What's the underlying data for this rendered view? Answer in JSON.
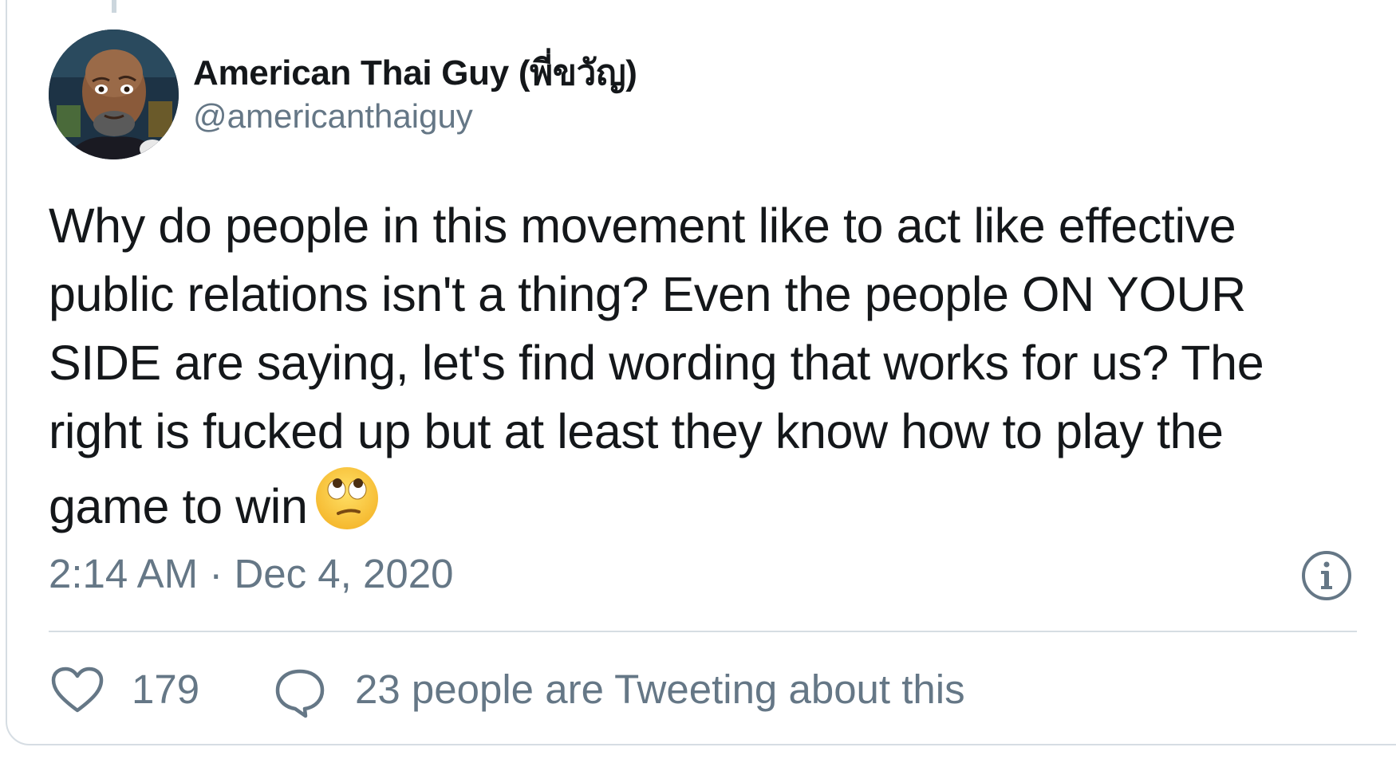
{
  "tweet": {
    "author": {
      "display_name": "American Thai Guy (พี่ขวัญ)",
      "handle": "@americanthaiguy"
    },
    "text": "Why do people in this movement like to act like effective public relations isn't a thing? Even the people ON YOUR SIDE are saying, let's find wording that works for us? The right is fucked up but at least they know how to play the game to win",
    "emoji": "face-with-rolling-eyes-emoji",
    "timestamp": "2:14 AM · Dec 4, 2020",
    "likes": "179",
    "reply_summary": "23 people are Tweeting about this"
  },
  "icons": {
    "info": "info-icon",
    "like": "heart-icon",
    "reply": "speech-bubble-icon"
  },
  "colors": {
    "text_primary": "#14171a",
    "text_secondary": "#657786",
    "border": "#d6dde3"
  }
}
